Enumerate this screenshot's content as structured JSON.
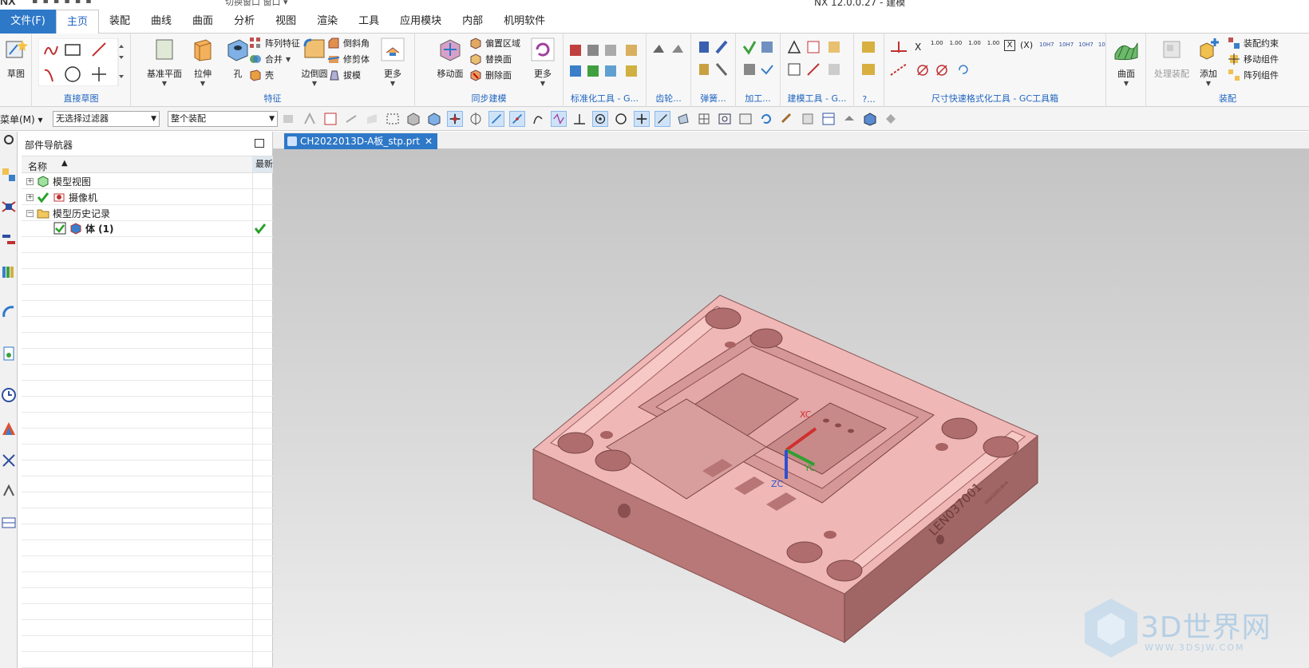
{
  "app": {
    "logo": "NX",
    "quick_access_text": "切换窗口  窗口 ▾",
    "title": "NX 12.0.0.27 - 建模"
  },
  "menu": {
    "file_label": "文件(F)",
    "tabs": [
      "主页",
      "装配",
      "曲线",
      "曲面",
      "分析",
      "视图",
      "渲染",
      "工具",
      "应用模块",
      "内部",
      "机明软件"
    ]
  },
  "ribbon": {
    "sketch_label": "草图",
    "groups": {
      "direct_sketch": "直接草图",
      "feature": "特征",
      "sync_modeling": "同步建模",
      "standard_tools": "标准化工具 - G...",
      "gear": "齿轮...",
      "spring": "弹簧...",
      "machining": "加工...",
      "modeling_tools": "建模工具 - G...",
      "more": "?...",
      "dimension_tools": "尺寸快速格式化工具 - GC工具箱",
      "surface": "曲面",
      "assembly": "装配"
    },
    "feature": {
      "datum_plane": "基准平面",
      "extrude": "拉伸",
      "hole": "孔",
      "pattern_feature": "阵列特征",
      "unite": "合并",
      "shell": "壳",
      "edge_blend": "边倒圆",
      "chamfer": "倒斜角",
      "trim_body": "修剪体",
      "draft": "拔模",
      "more": "更多"
    },
    "sync": {
      "move_face": "移动面",
      "offset_region": "偏置区域",
      "replace_face": "替换面",
      "delete_face": "删除面",
      "more": "更多"
    },
    "dimension_labels": [
      "1.00",
      "1.00",
      "1.00",
      "1.00",
      "10H7",
      "10H7",
      "10H7",
      "10"
    ],
    "surface_label": "曲面",
    "assembly": {
      "process_assembly": "处理装配",
      "add": "添加",
      "constraint": "装配约束",
      "move_component": "移动组件",
      "pattern_component": "阵列组件"
    }
  },
  "filterbar": {
    "menu_label": "菜单(M) ▾",
    "type_filter": "无选择过滤器",
    "scope": "整个装配"
  },
  "navigator": {
    "title": "部件导航器",
    "col_name": "名称",
    "col_latest": "最新",
    "nodes": [
      {
        "label": "模型视图"
      },
      {
        "label": "摄像机"
      },
      {
        "label": "模型历史记录"
      },
      {
        "label": "体 (1)"
      }
    ]
  },
  "document": {
    "tab_label": "CH2022013D-A板_stp.prt",
    "close_glyph": "✕"
  },
  "viewport": {
    "part_color": "#e8a4a4",
    "axis_labels": {
      "x": "XC",
      "y": "YC",
      "z": "ZC"
    },
    "side_engraving": "LEN037001",
    "side_small_text": "CH2022013D-A"
  },
  "watermark": {
    "text": "3D世界网",
    "url": "WWW.3DSJW.COM"
  },
  "colors": {
    "accent": "#2e78c8",
    "group_label": "#1f64c0",
    "check_green": "#2aa02a"
  }
}
